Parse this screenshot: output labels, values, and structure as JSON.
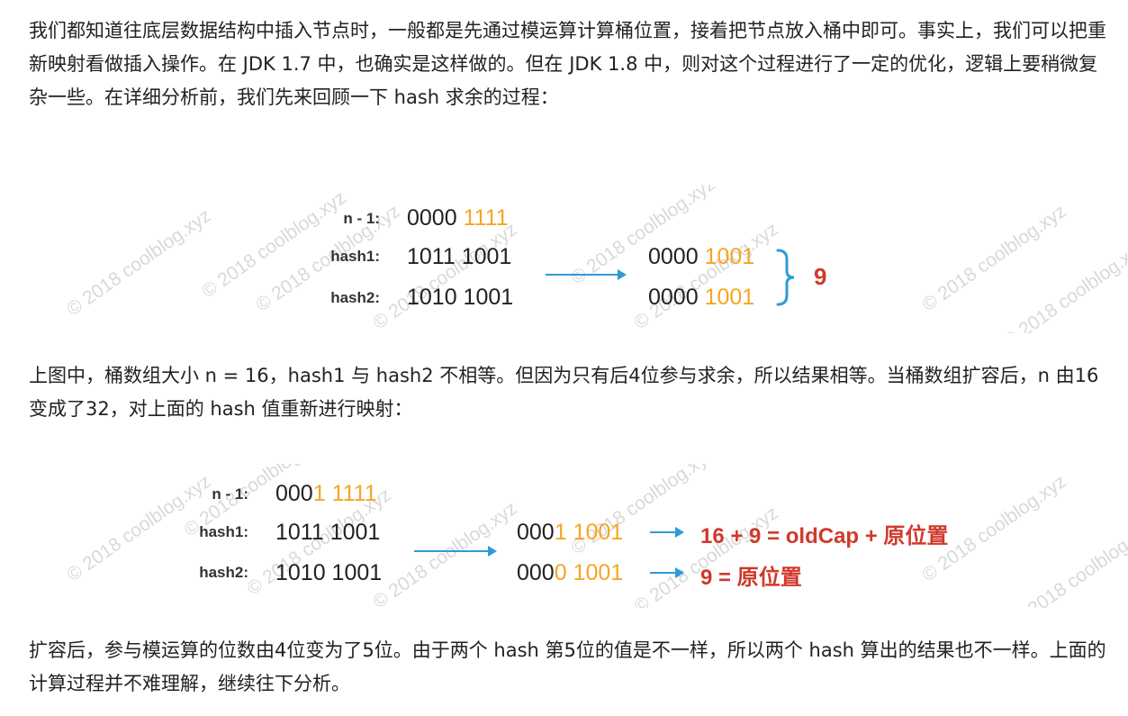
{
  "paragraphs": {
    "p1": "我们都知道往底层数据结构中插入节点时，一般都是先通过模运算计算桶位置，接着把节点放入桶中即可。事实上，我们可以把重新映射看做插入操作。在 JDK 1.7 中，也确实是这样做的。但在 JDK 1.8 中，则对这个过程进行了一定的优化，逻辑上要稍微复杂一些。在详细分析前，我们先来回顾一下 hash 求余的过程：",
    "p2": "上图中，桶数组大小 n = 16，hash1 与 hash2 不相等。但因为只有后4位参与求余，所以结果相等。当桶数组扩容后，n 由16变成了32，对上面的 hash 值重新进行映射：",
    "p3": "扩容后，参与模运算的位数由4位变为了5位。由于两个 hash 第5位的值是不一样，所以两个 hash 算出的结果也不一样。上面的计算过程并不难理解，继续往下分析。"
  },
  "figure1": {
    "labels": {
      "n": "n - 1:",
      "h1": "hash1:",
      "h2": "hash2:"
    },
    "n_value": {
      "plain": "0000 ",
      "highlight": "1111"
    },
    "hash1": "1011 1001",
    "hash2": "1010 1001",
    "result1": {
      "plain": "0000 ",
      "highlight": "1001"
    },
    "result2": {
      "plain": "0000 ",
      "highlight": "1001"
    },
    "bucket": "9"
  },
  "figure2": {
    "labels": {
      "n": "n - 1:",
      "h1": "hash1:",
      "h2": "hash2:"
    },
    "n_value": {
      "plain": "000",
      "highlight": "1 1111"
    },
    "hash1": "1011 1001",
    "hash2": "1010 1001",
    "result1": {
      "plain": "000",
      "highlight": "1 1001"
    },
    "result2": {
      "plain": "000",
      "highlight": "0 1001"
    },
    "note1": "16 + 9 = oldCap + 原位置",
    "note2": "9 = 原位置"
  },
  "watermark": "© 2018 coolblog.xyz",
  "colors": {
    "highlight": "#f5a623",
    "red": "#d0392b",
    "arrow": "#2e9bd6",
    "watermark": "#d9d9d9"
  }
}
